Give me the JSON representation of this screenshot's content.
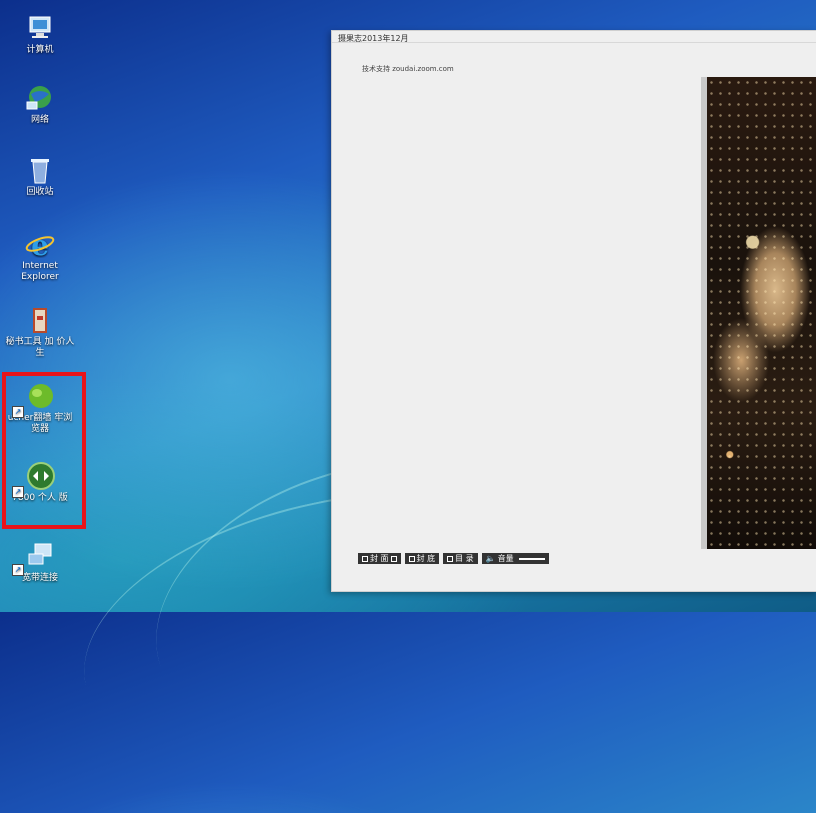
{
  "desktop": {
    "icons": [
      {
        "label": "计算机",
        "icon": "computer-icon"
      },
      {
        "label": "网络",
        "icon": "network-icon"
      },
      {
        "label": "回收站",
        "icon": "recycle-bin-icon"
      },
      {
        "label": "Internet Explorer",
        "icon": "internet-explorer-icon"
      },
      {
        "label": "秘书工具 加 价人生",
        "icon": "folder-icon"
      },
      {
        "label": "ucher翻墙 牢浏览器",
        "icon": "globe-icon"
      },
      {
        "label": "7800 个人 版",
        "icon": "connect-icon"
      },
      {
        "label": "宽带连接",
        "icon": "broadband-icon"
      }
    ],
    "highlight_color": "#e8141a"
  },
  "reader": {
    "title": "摄果志2013年12月",
    "support_text": "技术支持 zoudai.zoom.com",
    "toolbar": {
      "cover": "封 面",
      "back": "封 底",
      "toc": "目 录",
      "volume": "音量"
    }
  }
}
